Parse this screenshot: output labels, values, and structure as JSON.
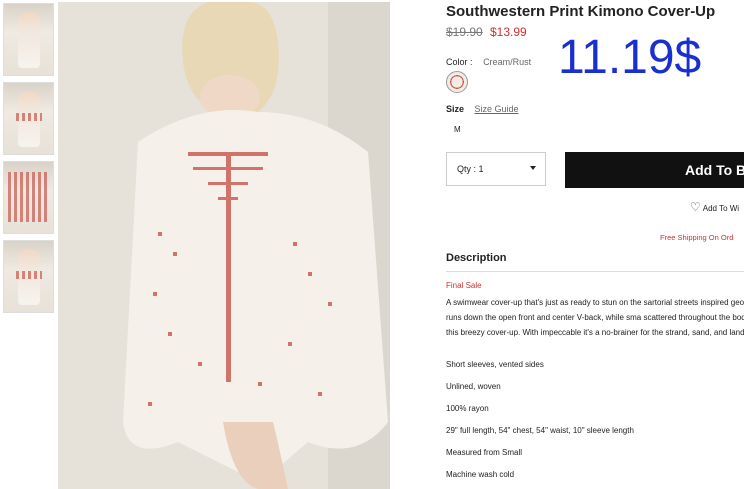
{
  "product": {
    "title": "Southwestern Print Kimono Cover-Up",
    "price_old": "$19.90",
    "price_new": "$13.99",
    "overlay_price": "11.19$"
  },
  "color": {
    "label": "Color",
    "value": "Cream/Rust"
  },
  "size": {
    "label": "Size",
    "guide": "Size Guide",
    "selected": "M"
  },
  "qty": {
    "label": "Qty : 1"
  },
  "buttons": {
    "add": "Add To B",
    "wishlist": "Add To Wi"
  },
  "shipping": "Free Shipping On Ord",
  "description": {
    "heading": "Description",
    "final_sale": "Final Sale",
    "paragraph": "A swimwear cover-up that's just as ready to stun on the sartorial streets inspired geo print runs down the open front and center V-back, while sma scattered throughout the body of this breezy cover-up. With impeccable it's a no-brainer for the strand, sand, and land.",
    "details": [
      "Short sleeves, vented sides",
      "Unlined, woven",
      "100% rayon",
      "29\" full length, 54\" chest, 54\" waist, 10\" sleeve length",
      "Measured from Small",
      "Machine wash cold"
    ]
  },
  "colors": {
    "accent": "#d0312d",
    "overlay": "#1a2fd1",
    "button_bg": "#111111"
  }
}
